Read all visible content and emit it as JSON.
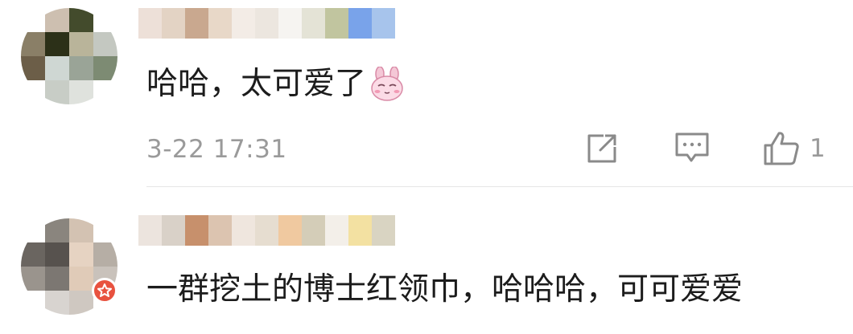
{
  "comments": [
    {
      "text": "哈哈，太可爱了",
      "emoji_icon": "bunny-face-emoji",
      "timestamp": "3-22 17:31",
      "like_count": "1",
      "username_mosaic_colors": [
        "#ede0d8",
        "#e3d3c4",
        "#c9a88f",
        "#e8d8c8",
        "#f3ece6",
        "#ece6df",
        "#f6f4f1",
        "#e4e3d6",
        "#c1c59f",
        "#79a3ea",
        "#a7c4ec"
      ],
      "avatar_mosaic_colors": [
        "#ffffff",
        "#cdbfb0",
        "#434b2c",
        "#ffffff",
        "#8a7f67",
        "#2c3018",
        "#b9b49a",
        "#c4c8c1",
        "#6c5e48",
        "#cfd7d3",
        "#9aa497",
        "#7d8b73",
        "#ffffff",
        "#c8cdc6",
        "#dfe2dd",
        "#ffffff"
      ]
    },
    {
      "text": "一群挖土的博士红领巾，哈哈哈，可可爱爱",
      "timestamp": "",
      "like_count": "",
      "username_mosaic_colors": [
        "#ece4de",
        "#d9d1c8",
        "#c7906c",
        "#dcc4b0",
        "#efe6de",
        "#e6ddd0",
        "#f0c9a0",
        "#d4cdb8",
        "#f3efe9",
        "#f3e1a2",
        "#d9d4c2"
      ],
      "avatar_mosaic_colors": [
        "#ffffff",
        "#8a857e",
        "#d3c2b2",
        "#ffffff",
        "#6a6560",
        "#57524e",
        "#e6d3c2",
        "#b6aea5",
        "#9a948d",
        "#7c7772",
        "#e0cbb8",
        "#c9c2bb",
        "#ffffff",
        "#d8d4d0",
        "#cfc8c1",
        "#ffffff"
      ],
      "badge_icon": "star-badge-icon",
      "badge_color": "#e8523f"
    }
  ],
  "actions": {
    "forward_icon": "forward-icon",
    "reply_icon": "reply-icon",
    "like_icon": "thumbs-up-icon"
  },
  "colors": {
    "text_primary": "#1c1c1c",
    "text_secondary": "#9a9a9a",
    "divider": "#e6e6e6"
  }
}
